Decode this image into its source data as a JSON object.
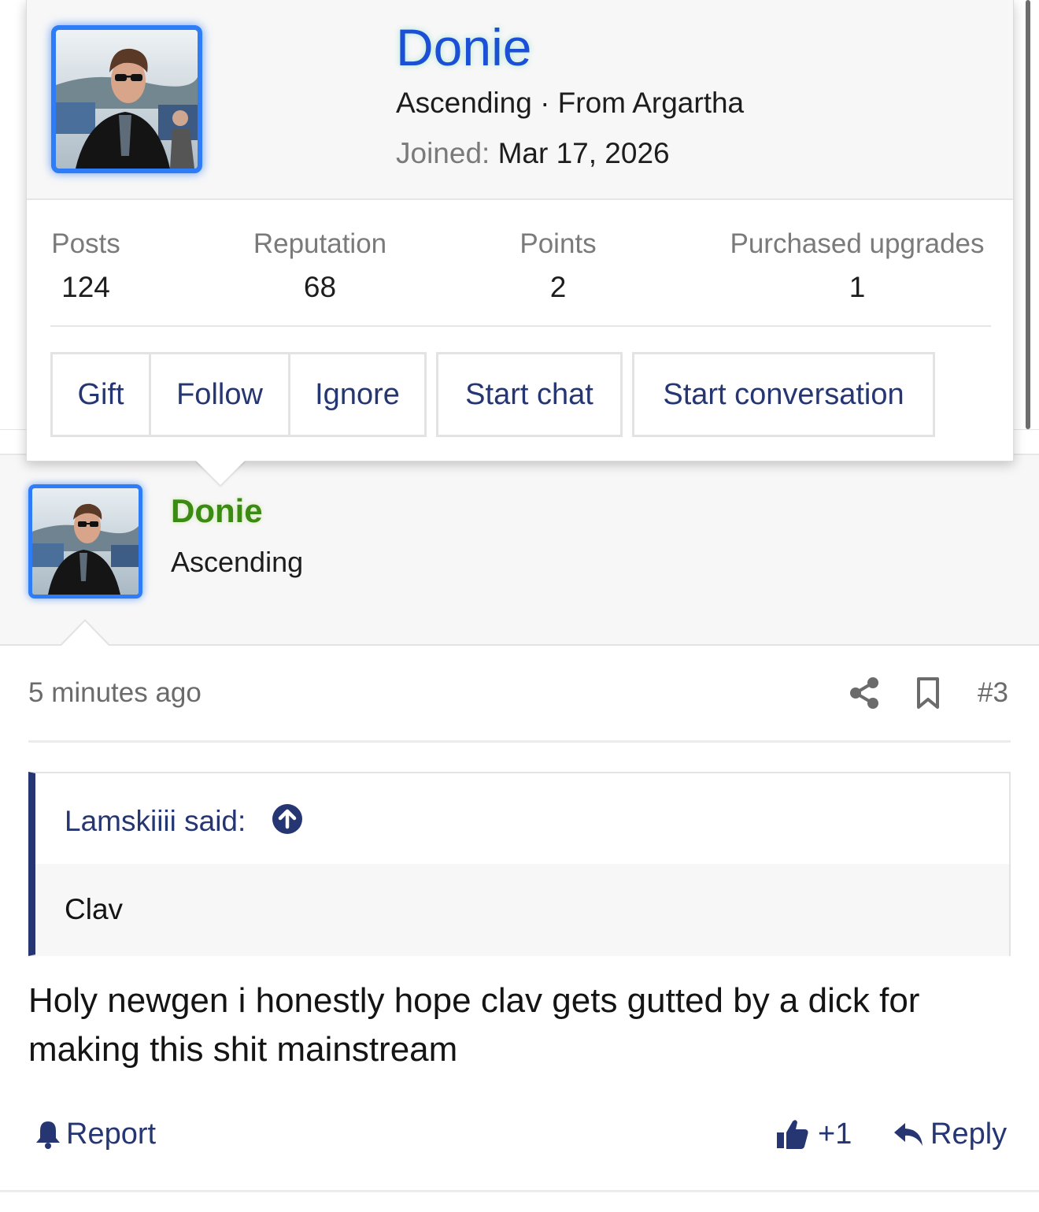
{
  "popup": {
    "username": "Donie",
    "user_title_line": "Ascending · From Argartha",
    "joined_label": "Joined:",
    "joined_date": "Mar 17, 2026",
    "stats": [
      {
        "label": "Posts",
        "value": "124"
      },
      {
        "label": "Reputation",
        "value": "68"
      },
      {
        "label": "Points",
        "value": "2"
      },
      {
        "label": "Purchased upgrades",
        "value": "1"
      }
    ],
    "actions": {
      "gift": "Gift",
      "follow": "Follow",
      "ignore": "Ignore",
      "start_chat": "Start chat",
      "start_conversation": "Start conversation"
    }
  },
  "post": {
    "username": "Donie",
    "user_title": "Ascending",
    "time": "5 minutes ago",
    "number": "#3",
    "quote": {
      "author": "Lamskiiii said:",
      "text": "Clav"
    },
    "message": "Holy newgen i honestly hope clav gets gutted by a dick for making this shit mainstream",
    "report_label": "Report",
    "reaction_count": "+1",
    "reply_label": "Reply"
  },
  "colors": {
    "accent": "#253672",
    "popup_username": "#1a4fd6",
    "post_username": "#3a8a14",
    "avatar_border": "#2f7df6"
  }
}
